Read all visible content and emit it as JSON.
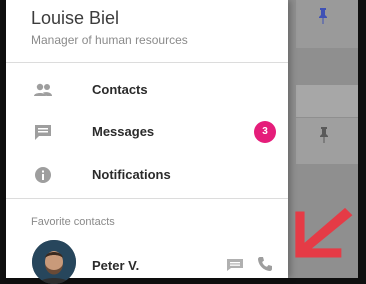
{
  "profile": {
    "name": "Louise Biel",
    "role": "Manager of human resources"
  },
  "menu": [
    {
      "label": "Contacts",
      "icon": "people-icon"
    },
    {
      "label": "Messages",
      "icon": "message-icon",
      "badge": "3"
    },
    {
      "label": "Notifications",
      "icon": "info-icon"
    }
  ],
  "favorites": {
    "section_title": "Favorite contacts",
    "contacts": [
      {
        "name": "Peter V."
      }
    ]
  },
  "colors": {
    "badge": "#e51d7a",
    "arrow": "#e53b46",
    "icon": "#9e9e9e",
    "pin": "#3f51b5"
  }
}
